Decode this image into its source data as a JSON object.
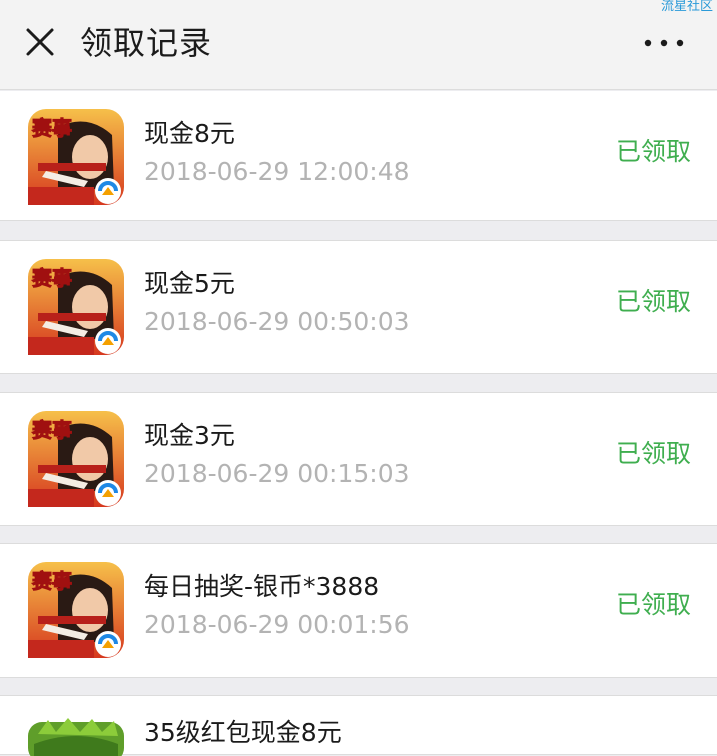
{
  "header": {
    "title": "领取记录",
    "watermark": "流星社区"
  },
  "colors": {
    "status_green": "#3fae4f",
    "header_bg": "#f3f3f3",
    "divider_bg": "#ededf0"
  },
  "icons": {
    "close": "close-icon",
    "more": "more-icon",
    "app": "game-app-icon"
  },
  "records": [
    {
      "title": "现金8元",
      "time": "2018-06-29 12:00:48",
      "status": "已领取"
    },
    {
      "title": "现金5元",
      "time": "2018-06-29 00:50:03",
      "status": "已领取"
    },
    {
      "title": "现金3元",
      "time": "2018-06-29 00:15:03",
      "status": "已领取"
    },
    {
      "title": "每日抽奖-银币*3888",
      "time": "2018-06-29 00:01:56",
      "status": "已领取"
    },
    {
      "title": "35级红包现金8元",
      "time": "",
      "status": ""
    }
  ]
}
